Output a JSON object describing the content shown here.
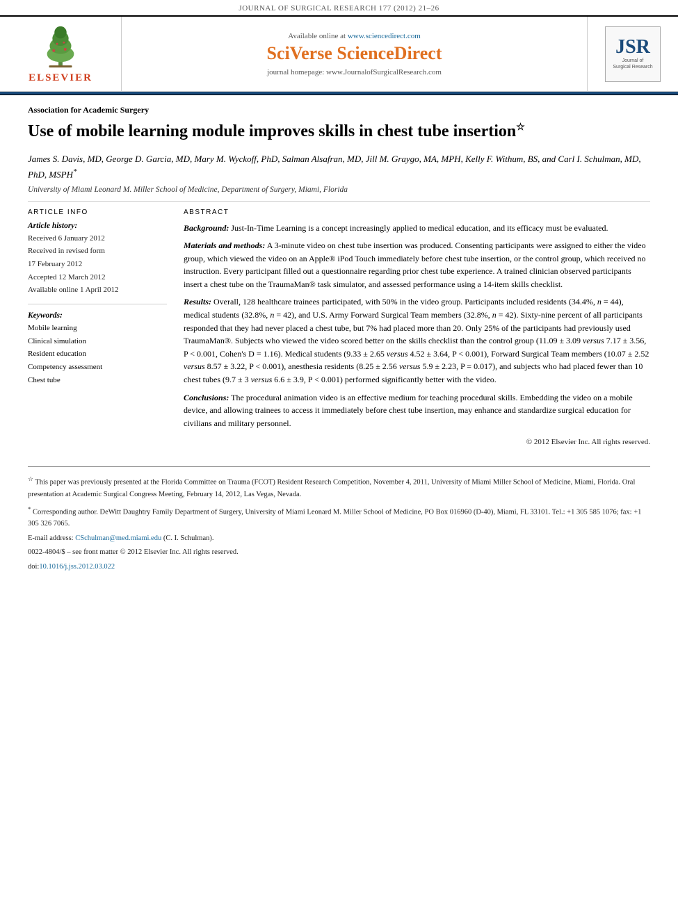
{
  "journal": {
    "name": "JOURNAL OF SURGICAL RESEARCH",
    "volume": "177 (2012) 21–26",
    "header_text": "JOURNAL OF SURGICAL RESEARCH 177 (2012) 21–26"
  },
  "banner": {
    "available_online_label": "Available online at",
    "available_online_url": "www.sciencedirect.com",
    "sciverse_label": "SciVerse ScienceDirect",
    "journal_homepage_label": "journal homepage: www.JournalofSurgicalResearch.com",
    "elsevier_text": "ELSEVIER",
    "jsr_letters": "JSR",
    "jsr_subtitle": "Journal of\nSurgical Research"
  },
  "article": {
    "section_tag": "Association for Academic Surgery",
    "title": "Use of mobile learning module improves skills in chest tube insertion",
    "title_star": "☆",
    "authors": "James S. Davis, MD, George D. Garcia, MD, Mary M. Wyckoff, PhD, Salman Alsafran, MD, Jill M. Graygo, MA, MPH, Kelly F. Withum, BS, and Carl I. Schulman, MD, PhD, MSPH",
    "authors_star": "*",
    "affiliation": "University of Miami Leonard M. Miller School of Medicine, Department of Surgery, Miami, Florida"
  },
  "article_info": {
    "header": "ARTICLE INFO",
    "history_label": "Article history:",
    "dates": [
      "Received 6 January 2012",
      "Received in revised form",
      "17 February 2012",
      "Accepted 12 March 2012",
      "Available online 1 April 2012"
    ],
    "keywords_label": "Keywords:",
    "keywords": [
      "Mobile learning",
      "Clinical simulation",
      "Resident education",
      "Competency assessment",
      "Chest tube"
    ]
  },
  "abstract": {
    "header": "ABSTRACT",
    "background_label": "Background:",
    "background_text": "Just-In-Time Learning is a concept increasingly applied to medical education, and its efficacy must be evaluated.",
    "methods_label": "Materials and methods:",
    "methods_text": "A 3-minute video on chest tube insertion was produced. Consenting participants were assigned to either the video group, which viewed the video on an Apple® iPod Touch immediately before chest tube insertion, or the control group, which received no instruction. Every participant filled out a questionnaire regarding prior chest tube experience. A trained clinician observed participants insert a chest tube on the TraumaMan® task simulator, and assessed performance using a 14-item skills checklist.",
    "results_label": "Results:",
    "results_text": "Overall, 128 healthcare trainees participated, with 50% in the video group. Participants included residents (34.4%, n = 44), medical students (32.8%, n = 42), and U.S. Army Forward Surgical Team members (32.8%, n = 42). Sixty-nine percent of all participants responded that they had never placed a chest tube, but 7% had placed more than 20. Only 25% of the participants had previously used TraumaMan®. Subjects who viewed the video scored better on the skills checklist than the control group (11.09 ± 3.09 versus 7.17 ± 3.56, P < 0.001, Cohen's D = 1.16). Medical students (9.33 ± 2.65 versus 4.52 ± 3.64, P < 0.001), Forward Surgical Team members (10.07 ± 2.52 versus 8.57 ± 3.22, P < 0.001), anesthesia residents (8.25 ± 2.56 versus 5.9 ± 2.23, P = 0.017), and subjects who had placed fewer than 10 chest tubes (9.7 ± 3 versus 6.6 ± 3.9, P < 0.001) performed significantly better with the video.",
    "conclusions_label": "Conclusions:",
    "conclusions_text": "The procedural animation video is an effective medium for teaching procedural skills. Embedding the video on a mobile device, and allowing trainees to access it immediately before chest tube insertion, may enhance and standardize surgical education for civilians and military personnel.",
    "copyright": "© 2012 Elsevier Inc. All rights reserved."
  },
  "footnotes": {
    "star_note": "☆ This paper was previously presented at the Florida Committee on Trauma (FCOT) Resident Research Competition, November 4, 2011, University of Miami Miller School of Medicine, Miami, Florida. Oral presentation at Academic Surgical Congress Meeting, February 14, 2012, Las Vegas, Nevada.",
    "corresponding_note": "* Corresponding author. DeWitt Daughtry Family Department of Surgery, University of Miami Leonard M. Miller School of Medicine, PO Box 016960 (D-40), Miami, FL 33101. Tel.: +1 305 585 1076; fax: +1 305 326 7065.",
    "email_label": "E-mail address:",
    "email_address": "CSchulman@med.miami.edu",
    "email_name": "(C. I. Schulman).",
    "issn_line": "0022-4804/$ – see front matter © 2012 Elsevier Inc. All rights reserved.",
    "doi": "doi:10.1016/j.jss.2012.03.022"
  }
}
